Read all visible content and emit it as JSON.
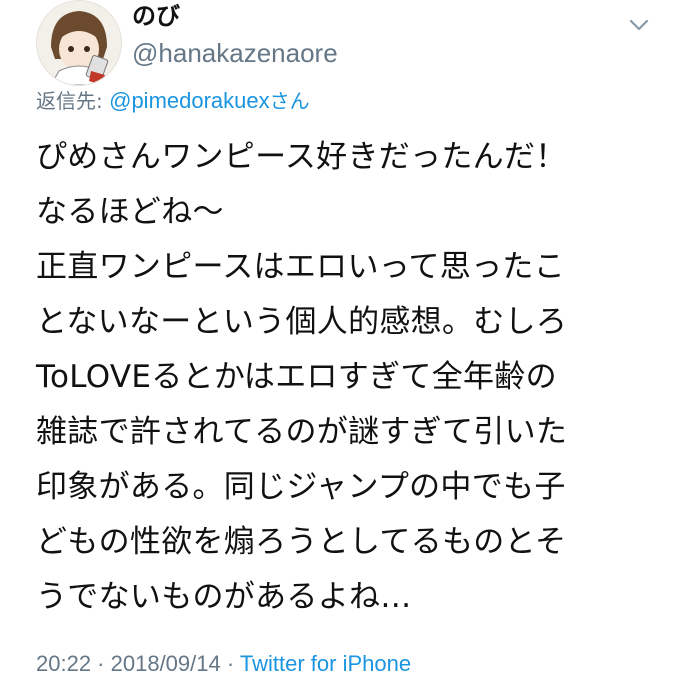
{
  "user": {
    "display_name": "のび",
    "handle": "@hanakazenaore"
  },
  "reply": {
    "label": "返信先: ",
    "user": "@pimedorakuex",
    "suffix": "さん"
  },
  "tweet": {
    "lines": [
      "ぴめさんワンピース好きだったんだ！",
      "なるほどね〜",
      "正直ワンピースはエロいって思ったこ",
      "とないなーという個人的感想。むしろ",
      "ToLOVEるとかはエロすぎて全年齢の",
      "雑誌で許されてるのが謎すぎて引いた",
      "印象がある。同じジャンプの中でも子",
      "どもの性欲を煽ろうとしてるものとそ",
      "うでないものがあるよね…"
    ]
  },
  "meta": {
    "time": "20:22",
    "separator": " · ",
    "date": "2018/09/14",
    "source": "Twitter for iPhone"
  },
  "icons": {
    "more": "chevron-down-icon",
    "avatar": "avatar"
  },
  "colors": {
    "text": "#111111",
    "secondary": "#657786",
    "link": "#1b95e0"
  }
}
